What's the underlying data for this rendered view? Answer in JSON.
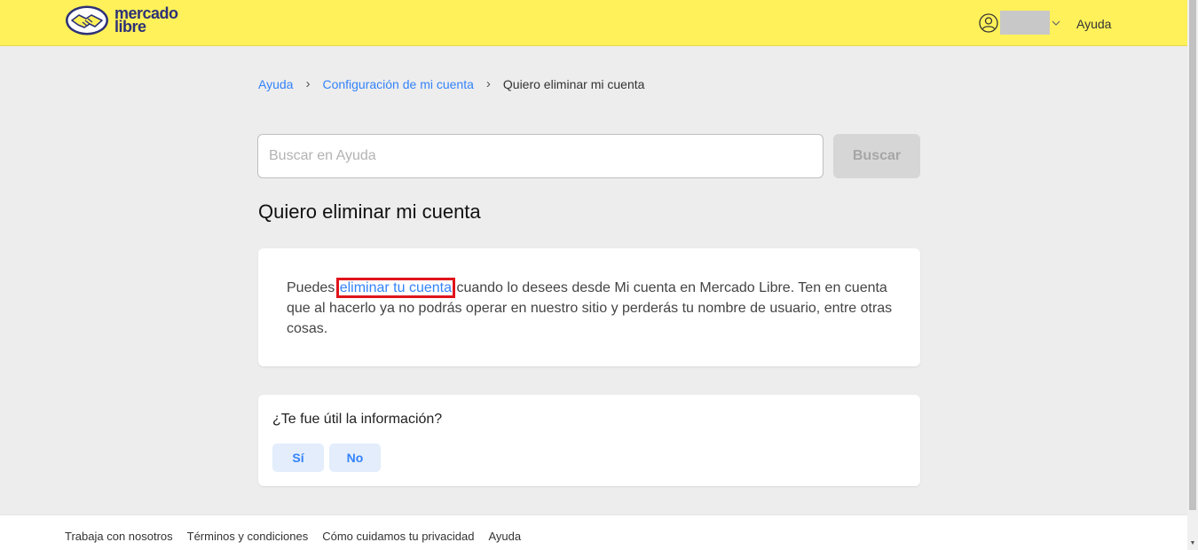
{
  "header": {
    "logo_line1": "mercado",
    "logo_line2": "libre",
    "help_label": "Ayuda",
    "bg_color": "#fff159"
  },
  "breadcrumb": {
    "items": [
      "Ayuda",
      "Configuración de mi cuenta"
    ],
    "current": "Quiero eliminar mi cuenta"
  },
  "search": {
    "placeholder": "Buscar en Ayuda",
    "button_label": "Buscar"
  },
  "page": {
    "title": "Quiero eliminar mi cuenta"
  },
  "article": {
    "text_before": "Puedes ",
    "link_text": "eliminar tu cuenta",
    "text_after": " cuando lo desees desde Mi cuenta en Mercado Libre. Ten en cuenta que al hacerlo ya no podrás operar en nuestro sitio y perderás tu nombre de usuario, entre otras cosas."
  },
  "feedback": {
    "question": "¿Te fue útil la información?",
    "yes_label": "Sí",
    "no_label": "No"
  },
  "footer": {
    "links": [
      "Trabaja con nosotros",
      "Términos y condiciones",
      "Cómo cuidamos tu privacidad",
      "Ayuda"
    ]
  },
  "colors": {
    "accent": "#3483fa",
    "highlight_box": "#e0141b"
  }
}
